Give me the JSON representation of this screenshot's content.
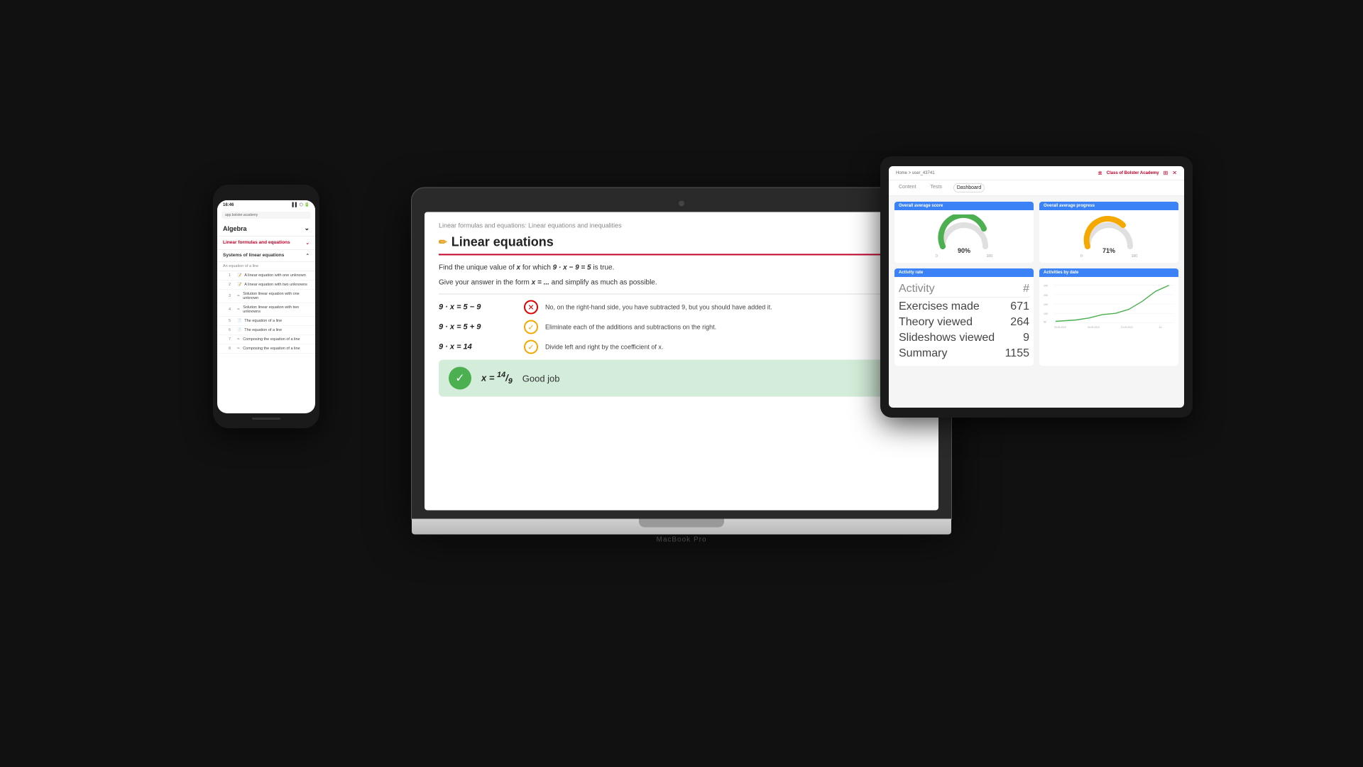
{
  "scene": {
    "background": "#111"
  },
  "laptop": {
    "label": "MacBook Pro",
    "content": {
      "breadcrumb": "Linear formulas and equations: Linear equations and inequalities",
      "title": "Linear equations",
      "question1": "Find the unique value of x for which 9 · x − 9 = 5 is true.",
      "question2": "Give your answer in the form x = ... and simplify as much as possible.",
      "answers": [
        {
          "formula": "9 · x = 5 − 9",
          "type": "wrong",
          "text": "No, on the right-hand side, you have subtracted 9, but you should have added it."
        },
        {
          "formula": "9 · x = 5 + 9",
          "type": "correct",
          "text": "Eliminate each of the additions and subtractions on the right."
        },
        {
          "formula": "9 · x = 14",
          "type": "correct",
          "text": "Divide left and right by the coefficient of x."
        }
      ],
      "success": {
        "formula": "x = 14/9",
        "message": "Good job"
      }
    }
  },
  "phone": {
    "time": "16:46",
    "url": "app.bolster.academy",
    "subject": "Algebra",
    "menu_items": [
      {
        "label": "Linear formulas and equations",
        "type": "expanded"
      },
      {
        "label": "Systems of linear equations",
        "type": "section"
      },
      {
        "label": "An equation of a line",
        "type": "sub-header"
      }
    ],
    "list_items": [
      "A linear equation with one unknown",
      "A linear equation with two unknowns",
      "Solution linear equation with one unknown",
      "Solution linear equation with two unknowns",
      "The equation of a line",
      "The equation of a line",
      "Composing the equation of a line",
      "Composing the equation of a line"
    ]
  },
  "tablet": {
    "breadcrumb": "Home > user_43741",
    "academy": "Class of Bolster Academy",
    "tabs": [
      "Content",
      "Tests",
      "Dashboard"
    ],
    "active_tab": "Dashboard",
    "cards": [
      {
        "header": "Overall average score",
        "type": "gauge",
        "value": 90,
        "color": "#4caf50",
        "max": 100,
        "min": 0
      },
      {
        "header": "Overall average progress",
        "type": "gauge",
        "value": 71,
        "color": "#f5a800",
        "max": 100,
        "min": 0
      },
      {
        "header": "Activity rate",
        "type": "table",
        "columns": [
          "Activity",
          "#"
        ],
        "rows": [
          {
            "activity": "Exercises made",
            "value": "671"
          },
          {
            "activity": "Theory viewed",
            "value": "264"
          },
          {
            "activity": "Slideshows viewed",
            "value": "9"
          },
          {
            "activity": "Summary",
            "value": "1155"
          }
        ]
      },
      {
        "header": "Activities by date",
        "type": "chart",
        "y_labels": [
          "250",
          "200",
          "150",
          "100",
          "50"
        ],
        "x_labels": [
          "03-05-2020",
          "05-05-2020",
          "10-05-2020",
          "24-"
        ],
        "line_color": "#4caf50"
      }
    ]
  }
}
